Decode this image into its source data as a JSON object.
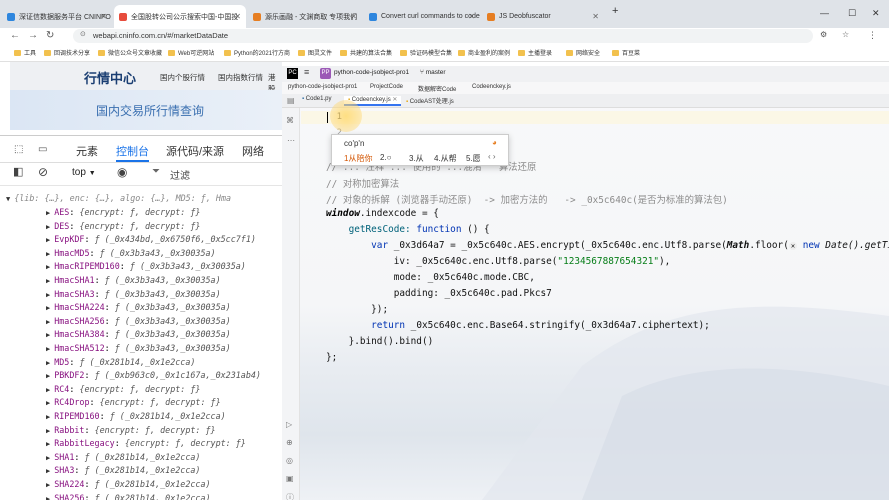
{
  "browser": {
    "tabs": [
      {
        "label": "深证信数据服务平台 CNINFO",
        "color": "#c0392b"
      },
      {
        "label": "全国股转公司公示搜索中国-中国投",
        "color": "#e74c3c"
      },
      {
        "label": "源乐画融 - 文渊商取 专项我们",
        "color": "#e67e22"
      },
      {
        "label": "Convert curl commands to code",
        "color": "#2e86de"
      },
      {
        "label": "JS Deobfuscator",
        "color": "#e67e22"
      }
    ],
    "new_tab": "+",
    "url": "webapi.cninfo.com.cn/#/marketDataDate",
    "bookmarks": [
      "工具",
      "回调技术分享",
      "微信公众号文章收藏",
      "Web可逆网站",
      "Python的2021行方商",
      "图灵文件",
      "共建的算法合集",
      "验证码模型合集",
      "商业盈利的案例",
      "主播登录",
      "网络安全",
      "百豆菜"
    ]
  },
  "page": {
    "nav": [
      "行情中心",
      "国内个股行情",
      "国内指数行情",
      "港股"
    ],
    "banner_title": "国内交易所行情查询"
  },
  "devtools": {
    "tabs": [
      "元素",
      "控制台",
      "源代码/来源",
      "网络"
    ],
    "active_tab": "控制台",
    "context": "top",
    "filter_placeholder": "过滤",
    "summary": "{lib: {…}, enc: {…}, algo: {…}, MD5: ƒ, Hma",
    "entries": [
      {
        "key": "AES",
        "value": "{encrypt: ƒ, decrypt: ƒ}"
      },
      {
        "key": "DES",
        "value": "{encrypt: ƒ, decrypt: ƒ}"
      },
      {
        "key": "EvpKDF",
        "value": "ƒ (_0x434bd,_0x6750f6,_0x5cc7f1)"
      },
      {
        "key": "HmacMD5",
        "value": "ƒ (_0x3b3a43,_0x30035a)"
      },
      {
        "key": "HmacRIPEMD160",
        "value": "ƒ (_0x3b3a43,_0x30035a)"
      },
      {
        "key": "HmacSHA1",
        "value": "ƒ (_0x3b3a43,_0x30035a)"
      },
      {
        "key": "HmacSHA3",
        "value": "ƒ (_0x3b3a43,_0x30035a)"
      },
      {
        "key": "HmacSHA224",
        "value": "ƒ (_0x3b3a43,_0x30035a)"
      },
      {
        "key": "HmacSHA256",
        "value": "ƒ (_0x3b3a43,_0x30035a)"
      },
      {
        "key": "HmacSHA384",
        "value": "ƒ (_0x3b3a43,_0x30035a)"
      },
      {
        "key": "HmacSHA512",
        "value": "ƒ (_0x3b3a43,_0x30035a)"
      },
      {
        "key": "MD5",
        "value": "ƒ (_0x281b14,_0x1e2cca)"
      },
      {
        "key": "PBKDF2",
        "value": "ƒ (_0xb963c0,_0x1c167a,_0x231ab4)"
      },
      {
        "key": "RC4",
        "value": "{encrypt: ƒ, decrypt: ƒ}"
      },
      {
        "key": "RC4Drop",
        "value": "{encrypt: ƒ, decrypt: ƒ}"
      },
      {
        "key": "RIPEMD160",
        "value": "ƒ (_0x281b14,_0x1e2cca)"
      },
      {
        "key": "Rabbit",
        "value": "{encrypt: ƒ, decrypt: ƒ}"
      },
      {
        "key": "RabbitLegacy",
        "value": "{encrypt: ƒ, decrypt: ƒ}"
      },
      {
        "key": "SHA1",
        "value": "ƒ (_0x281b14,_0x1e2cca)"
      },
      {
        "key": "SHA3",
        "value": "ƒ (_0x281b14,_0x1e2cca)"
      },
      {
        "key": "SHA224",
        "value": "ƒ (_0x281b14,_0x1e2cca)"
      },
      {
        "key": "SHA256",
        "value": "ƒ (_0x281b14,_0x1e2cca)"
      }
    ]
  },
  "editor": {
    "project": "python-code-jsobject-pro1",
    "branch": "master",
    "breadcrumb": [
      "python-code-jsobject-pro1",
      "ProjectCode",
      "数据解密Code",
      "Codeenckey.js"
    ],
    "tabs": [
      "Code1.py",
      "Codeenckey.js",
      "CodeAST处理.js"
    ],
    "active_tab": "Codeenckey.js",
    "line_numbers": [
      "1",
      "2",
      "3"
    ],
    "typed": "co'p'n",
    "ime_candidates": [
      "1从陪你",
      "2.○",
      "3.从",
      "4.从帮",
      "5.愿"
    ],
    "code": {
      "c_top": "// ... 注释 ... 使用的 ...混淆   算法还原",
      "c1": "// 对称加密算法",
      "c2": "// 对象的拆解 (浏览器手动还原)  -> 加密方法的   -> _0x5c640c(是否为标准的算法包)",
      "l_window": "window",
      "l_window_rest": ".indexcode = {",
      "l_get": "    getResCode: ",
      "l_get_kw": "function",
      "l_get_rest": " () {",
      "l_var_kw": "        var",
      "l_var_rest": " _0x3d64a7 = _0x5c640c.AES.encrypt(_0x5c640c.enc.Utf8.parse(",
      "l_var_math": "Math",
      "l_var_floor": ".floor(",
      "l_var_new": "new",
      "l_var_date": " Date().getTi",
      "l_iv": "            iv: _0x5c640c.enc.Utf8.parse(",
      "l_iv_str": "\"1234567887654321\"",
      "l_iv_end": "),",
      "l_mode": "            mode: _0x5c640c.mode.CBC,",
      "l_pad": "            padding: _0x5c640c.pad.Pkcs7",
      "l_close1": "        });",
      "l_ret_kw": "        return",
      "l_ret_rest": " _0x5c640c.enc.Base64.stringify(_0x3d64a7.ciphertext);",
      "l_bind": "    }.bind().bind()",
      "l_end": "};"
    }
  }
}
